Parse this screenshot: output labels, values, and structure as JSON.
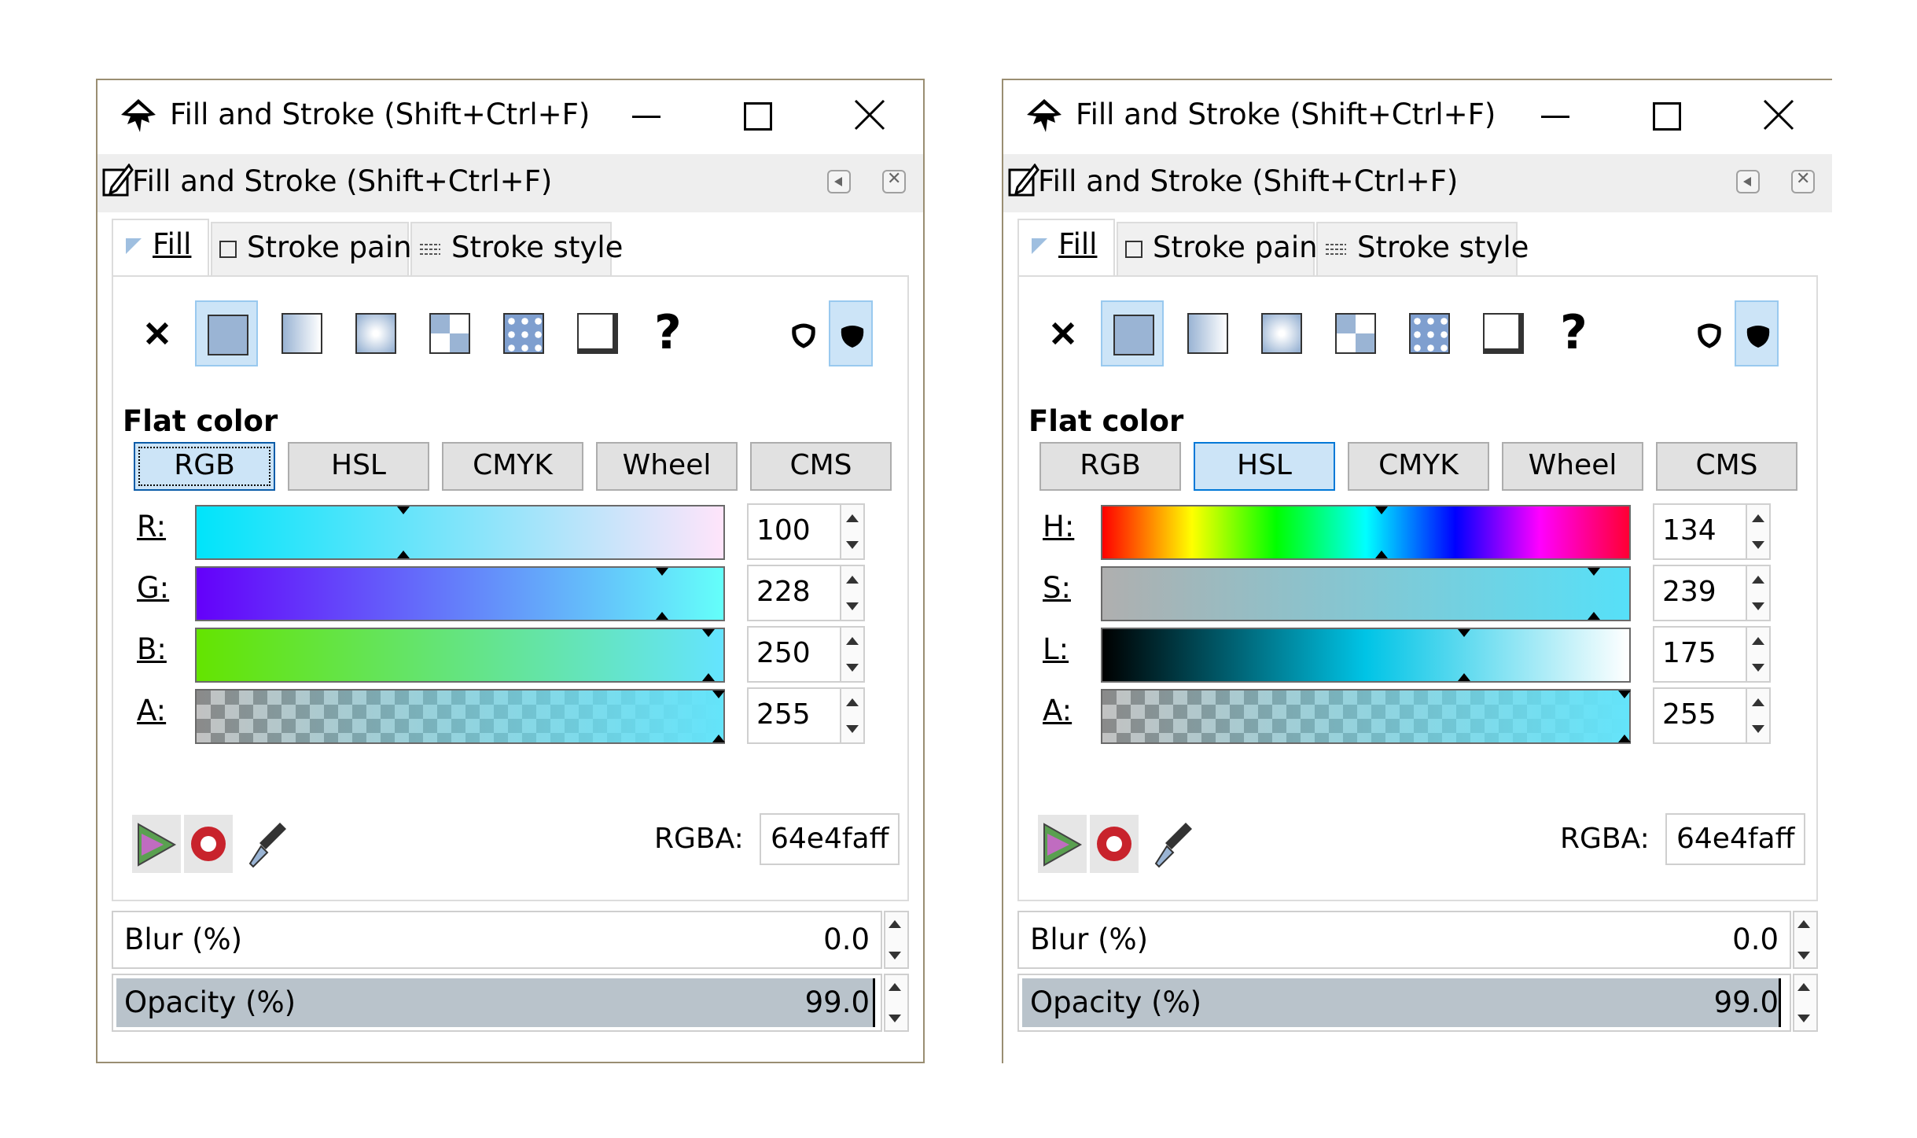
{
  "windows": [
    {
      "id": "win1",
      "title": "Fill and Stroke (Shift+Ctrl+F)",
      "dock_title": "Fill and Stroke (Shift+Ctrl+F)",
      "tabs": [
        "Fill",
        "Stroke paint",
        "Stroke style"
      ],
      "section_label": "Flat color",
      "color_tabs": [
        "RGB",
        "HSL",
        "CMYK",
        "Wheel",
        "CMS"
      ],
      "selected_color_tab": "RGB",
      "sliders": [
        {
          "label": "R:",
          "value": "100",
          "fraction": 0.39
        },
        {
          "label": "G:",
          "value": "228",
          "fraction": 0.89
        },
        {
          "label": "B:",
          "value": "250",
          "fraction": 0.98
        },
        {
          "label": "A:",
          "value": "255",
          "fraction": 1.0
        }
      ],
      "rgba_label": "RGBA:",
      "rgba_value": "64e4faff",
      "blur_label": "Blur (%)",
      "blur_value": "0.0",
      "opacity_label": "Opacity (%)",
      "opacity_value": "99.0"
    },
    {
      "id": "win2",
      "title": "Fill and Stroke (Shift+Ctrl+F)",
      "dock_title": "Fill and Stroke (Shift+Ctrl+F)",
      "tabs": [
        "Fill",
        "Stroke paint",
        "Stroke style"
      ],
      "section_label": "Flat color",
      "color_tabs": [
        "RGB",
        "HSL",
        "CMYK",
        "Wheel",
        "CMS"
      ],
      "selected_color_tab": "HSL",
      "sliders": [
        {
          "label": "H:",
          "value": "134",
          "fraction": 0.53
        },
        {
          "label": "S:",
          "value": "239",
          "fraction": 0.94
        },
        {
          "label": "L:",
          "value": "175",
          "fraction": 0.69
        },
        {
          "label": "A:",
          "value": "255",
          "fraction": 1.0
        }
      ],
      "rgba_label": "RGBA:",
      "rgba_value": "64e4faff",
      "blur_label": "Blur (%)",
      "blur_value": "0.0",
      "opacity_label": "Opacity (%)",
      "opacity_value": "99.0"
    }
  ],
  "icons": {
    "app": "inkscape-icon",
    "dock": "fill-stroke-pen-icon",
    "paint_modes": [
      "no-paint-icon",
      "flat-color-icon",
      "linear-gradient-icon",
      "radial-gradient-icon",
      "pattern-icon",
      "swatch-icon",
      "unset-paint-icon",
      "unknown-paint-icon"
    ],
    "fill_rules": [
      "fill-rule-evenodd-icon",
      "fill-rule-nonzero-icon"
    ],
    "bottom": [
      "color-managed-icon",
      "out-of-gamut-icon",
      "color-picker-icon"
    ]
  },
  "colors": {
    "selection_bg": "#cce4f7",
    "selection_border": "#0078d7",
    "current_color": "#64e4fa"
  }
}
